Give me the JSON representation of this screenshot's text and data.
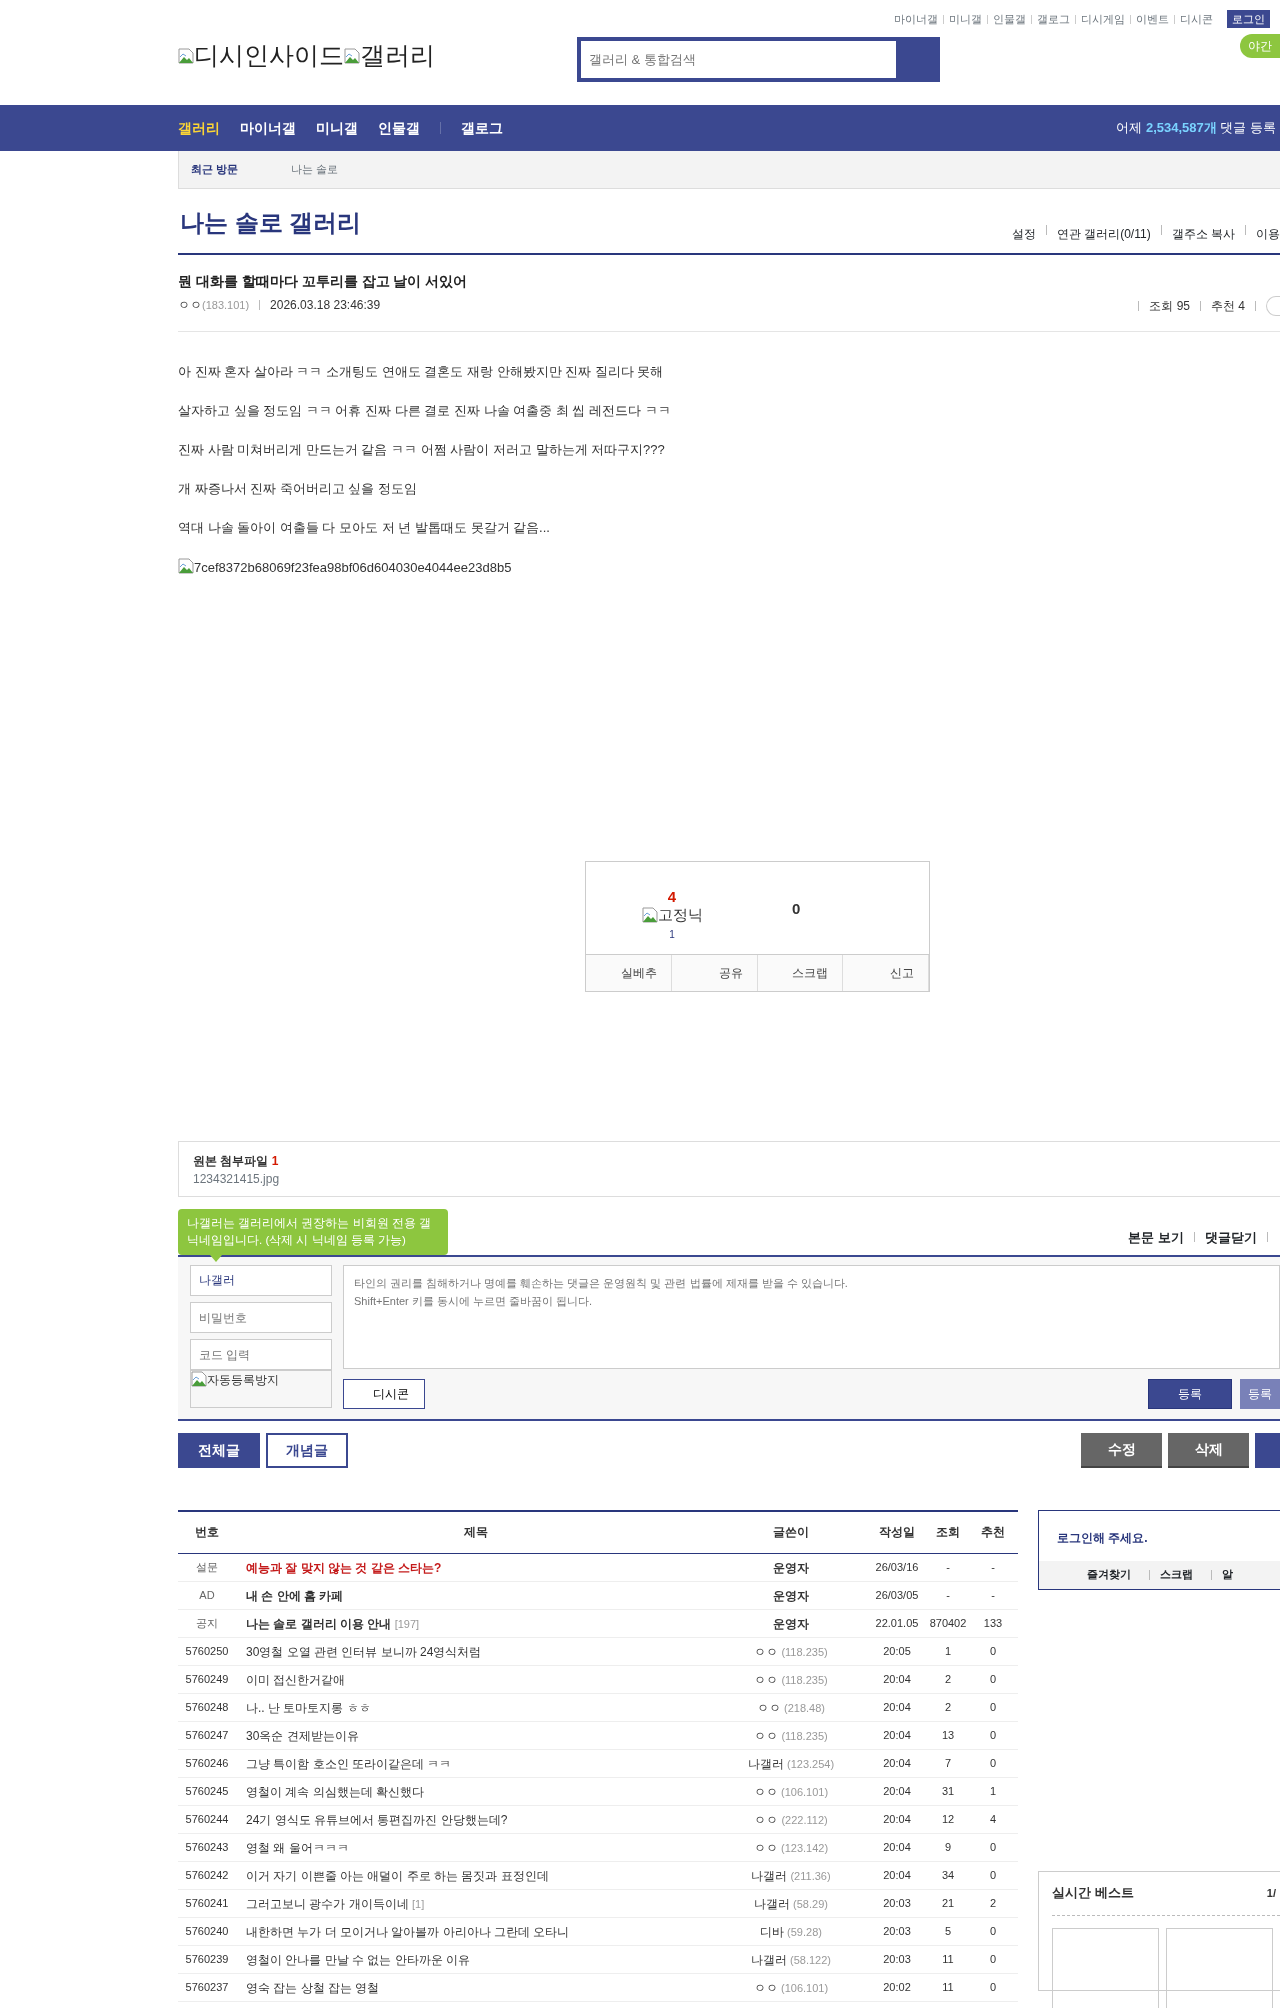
{
  "top_links": [
    "마이너갤",
    "미니갤",
    "인물갤",
    "갤로그",
    "디시게임",
    "이벤트",
    "디시콘"
  ],
  "login_button": "로그인",
  "logo": {
    "site": "디시인사이드",
    "section": "갤러리"
  },
  "search": {
    "placeholder": "갤러리 & 통합검색"
  },
  "night_mode": "야간",
  "nav": {
    "items": [
      {
        "label": "갤러리",
        "selected": true,
        "divider_before": false
      },
      {
        "label": "마이너갤",
        "selected": false,
        "divider_before": false
      },
      {
        "label": "미니갤",
        "selected": false,
        "divider_before": false
      },
      {
        "label": "인물갤",
        "selected": false,
        "divider_before": false
      },
      {
        "label": "갤로그",
        "selected": false,
        "divider_before": true
      }
    ],
    "stats": {
      "prefix": "어제",
      "count": "2,534,587개",
      "suffix": "댓글 등록"
    }
  },
  "recent": {
    "label": "최근 방문",
    "items": [
      "나는 솔로"
    ]
  },
  "gallery": {
    "title": "나는 솔로 갤러리",
    "links": [
      "설정",
      "연관 갤러리(0/11)",
      "갤주소 복사",
      "이용"
    ]
  },
  "post": {
    "title": "뭔 대화를 할때마다 꼬투리를 잡고 날이 서있어",
    "writer": "ㅇㅇ",
    "ip": "(183.101)",
    "date": "2026.03.18 23:46:39",
    "views": "조회 95",
    "recommend": "추천 4",
    "paragraphs": [
      "아 진짜 혼자 살아라 ㅋㅋ 소개팅도 연애도 결혼도 재랑 안해봤지만 진짜 질리다 못해",
      "살자하고 싶을 정도임 ㅋㅋ 어휴 진짜 다른 결로 진짜 나솔 여출중 최 씹 레전드다 ㅋㅋ",
      "진짜 사람 미쳐버리게 만드는거 같음 ㅋㅋ 어쩜 사람이 저러고 말하는게 저따구지???",
      "개 짜증나서 진짜 죽어버리고 싶을 정도임",
      "역대 나솔 돌아이 여출들 다 모아도 저 년 발톱때도 못갈거 같음..."
    ],
    "image_alt": "7cef8372b68069f23fea98bf06d604030e4044ee23d8b5"
  },
  "vote": {
    "up_count": "4",
    "fixed_label": "고정닉",
    "fixed_count": "1",
    "down_count": "0",
    "buttons": [
      "실베추",
      "공유",
      "스크랩",
      "신고"
    ]
  },
  "attachment": {
    "label": "원본 첨부파일",
    "count": "1",
    "file": "1234321415.jpg"
  },
  "comment": {
    "tooltip": "나갤러는 갤러리에서 권장하는 비회원 전용 갤닉네임입니다. (삭제 시 닉네임 등록 가능)",
    "links": [
      "본문 보기",
      "댓글닫기"
    ],
    "name_value": "나갤러",
    "password_placeholder": "비밀번호",
    "code_placeholder": "코드 입력",
    "captcha_alt": "자동등록방지",
    "textarea_placeholder": "타인의 권리를 침해하거나 명예를 훼손하는 댓글은 운영원칙 및 관련 법률에 제재를 받을 수 있습니다.\nShift+Enter 키를 동시에 누르면 줄바꿈이 됩니다.",
    "dccon": "디시콘",
    "submit": "등록",
    "submit2": "등록"
  },
  "list_tabs": [
    {
      "label": "전체글",
      "selected": true
    },
    {
      "label": "개념글",
      "selected": false
    }
  ],
  "post_buttons": [
    "수정",
    "삭제"
  ],
  "list": {
    "columns": [
      "번호",
      "제목",
      "글쓴이",
      "작성일",
      "조회",
      "추천"
    ],
    "rows": [
      {
        "kind": "survey",
        "num": "설문",
        "title": "예능과 잘 맞지 않는 것 같은 스타는?",
        "writer": "운영자",
        "date": "26/03/16",
        "views": "-",
        "recommend": "-"
      },
      {
        "kind": "ad",
        "num": "AD",
        "title": "내 손 안에 홈 카페",
        "writer": "운영자",
        "date": "26/03/05",
        "views": "-",
        "recommend": "-"
      },
      {
        "kind": "notice",
        "num": "공지",
        "title": "나는 솔로 갤러리 이용 안내",
        "replies": "[197]",
        "writer": "운영자",
        "date": "22.01.05",
        "views": "870402",
        "recommend": "133"
      },
      {
        "kind": "post",
        "num": "5760250",
        "title": "30영철 오열 관련 인터뷰 보니까 24영식처럼",
        "writer": "ㅇㅇ",
        "ip": "(118.235)",
        "date": "20:05",
        "views": "1",
        "recommend": "0"
      },
      {
        "kind": "post",
        "num": "5760249",
        "title": "이미 접신한거같애",
        "writer": "ㅇㅇ",
        "ip": "(118.235)",
        "date": "20:04",
        "views": "2",
        "recommend": "0"
      },
      {
        "kind": "post",
        "num": "5760248",
        "title": "나.. 난 토마토지롱 ㅎㅎ",
        "writer": "ㅇㅇ",
        "ip": "(218.48)",
        "date": "20:04",
        "views": "2",
        "recommend": "0"
      },
      {
        "kind": "post",
        "num": "5760247",
        "title": "30옥순 견제받는이유",
        "writer": "ㅇㅇ",
        "ip": "(118.235)",
        "date": "20:04",
        "views": "13",
        "recommend": "0"
      },
      {
        "kind": "post",
        "num": "5760246",
        "title": "그냥 특이함 호소인 또라이같은데 ㅋㅋ",
        "writer": "나갤러",
        "ip": "(123.254)",
        "date": "20:04",
        "views": "7",
        "recommend": "0"
      },
      {
        "kind": "post",
        "num": "5760245",
        "title": "영철이 계속 의심했는데 확신했다",
        "writer": "ㅇㅇ",
        "ip": "(106.101)",
        "date": "20:04",
        "views": "31",
        "recommend": "1"
      },
      {
        "kind": "post",
        "num": "5760244",
        "title": "24기 영식도 유튜브에서 통편집까진 안당했는데?",
        "writer": "ㅇㅇ",
        "ip": "(222.112)",
        "date": "20:04",
        "views": "12",
        "recommend": "4"
      },
      {
        "kind": "post",
        "num": "5760243",
        "title": "영철 왜 울어ㅋㅋㅋ",
        "writer": "ㅇㅇ",
        "ip": "(123.142)",
        "date": "20:04",
        "views": "9",
        "recommend": "0"
      },
      {
        "kind": "post",
        "num": "5760242",
        "title": "이거 자기 이쁜줄 아는 애덜이 주로 하는 몸짓과 표정인데",
        "writer": "나갤러",
        "ip": "(211.36)",
        "date": "20:04",
        "views": "34",
        "recommend": "0"
      },
      {
        "kind": "post",
        "num": "5760241",
        "title": "그러고보니 광수가 개이득이네",
        "replies": "[1]",
        "writer": "나갤러",
        "ip": "(58.29)",
        "date": "20:03",
        "views": "21",
        "recommend": "2"
      },
      {
        "kind": "post",
        "num": "5760240",
        "title": "내한하면 누가 더 모이거나 알아볼까 아리아나 그란데 오타니",
        "writer": "디바",
        "ip": "(59.28)",
        "date": "20:03",
        "views": "5",
        "recommend": "0"
      },
      {
        "kind": "post",
        "num": "5760239",
        "title": "영철이 안나를 만날 수 없는 안타까운 이유",
        "writer": "나갤러",
        "ip": "(58.122)",
        "date": "20:03",
        "views": "11",
        "recommend": "0"
      },
      {
        "kind": "post",
        "num": "5760237",
        "title": "영숙 잡는 상철 잡는 영철",
        "writer": "ㅇㅇ",
        "ip": "(106.101)",
        "date": "20:02",
        "views": "11",
        "recommend": "0"
      }
    ]
  },
  "sidebar": {
    "login_prompt": "로그인해 주세요.",
    "links": [
      "즐겨찾기",
      "스크랩",
      "알"
    ],
    "best_title": "실시간 베스트",
    "best_page": "1/"
  }
}
